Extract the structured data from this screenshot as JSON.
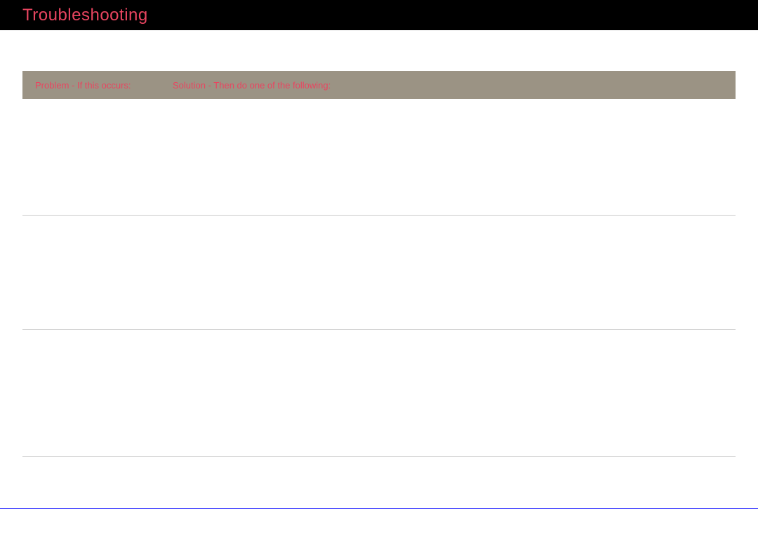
{
  "header": {
    "title": "Troubleshooting"
  },
  "table": {
    "columns": {
      "problem": "Problem - If this occurs:",
      "solution": "Solution - Then do one of the following:"
    },
    "rows": [
      {},
      {},
      {}
    ]
  }
}
